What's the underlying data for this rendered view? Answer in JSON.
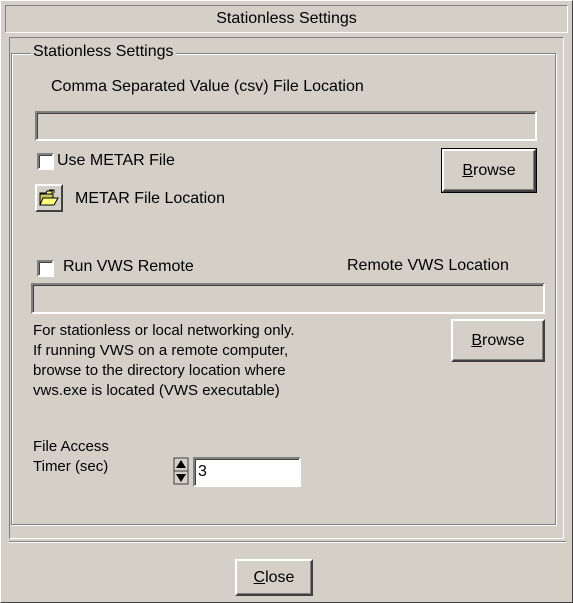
{
  "window": {
    "title": "Stationless Settings"
  },
  "group": {
    "legend": "Stationless Settings"
  },
  "csv": {
    "label": "Comma Separated Value (csv) File Location",
    "value": ""
  },
  "metar": {
    "checkbox_label": "Use METAR File",
    "checked": false,
    "browse_label": "Browse",
    "browse_mnemonic": "B",
    "browse_rest": "rowse",
    "location_label": "METAR File Location",
    "folder_icon": "folder-open-icon"
  },
  "vws": {
    "checkbox_label": "Run VWS Remote",
    "checked": false,
    "remote_label": "Remote VWS Location",
    "value": "",
    "browse_mnemonic": "B",
    "browse_rest": "rowse",
    "help_lines": [
      "For stationless or local networking only.",
      "If running VWS on a remote computer,",
      "browse to the directory location where",
      "vws.exe is located (VWS executable)"
    ]
  },
  "timer": {
    "label_line1": "File Access",
    "label_line2": "Timer (sec)",
    "value": "3"
  },
  "footer": {
    "close_mnemonic": "C",
    "close_rest": "lose"
  },
  "colors": {
    "face": "#d4d0c8",
    "shadow": "#808080",
    "dark_shadow": "#404040",
    "highlight": "#ffffff"
  }
}
